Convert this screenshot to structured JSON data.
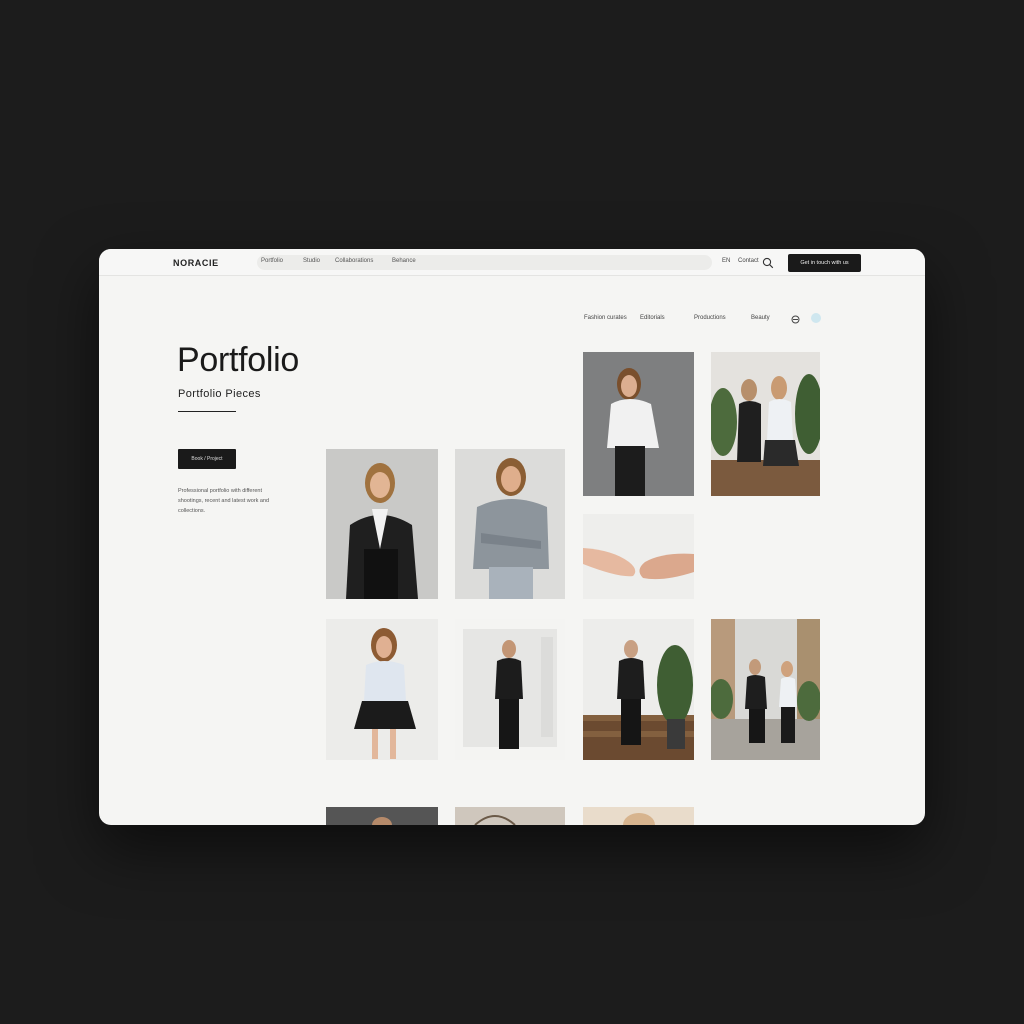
{
  "brand": "NORACIE",
  "nav": {
    "links": [
      "Portfolio",
      "Studio",
      "Collaborations",
      "Behance"
    ],
    "lang": "EN",
    "contact": "Contact",
    "cta": "Get in touch with us"
  },
  "filters": [
    "Fashion curates",
    "Editorials",
    "Productions",
    "Beauty"
  ],
  "hero": {
    "title": "Portfolio",
    "subtitle": "Portfolio Pieces",
    "button": "Book / Project",
    "description": "Professional portfolio with different shootings, recent and latest work and collections."
  },
  "gallery": [
    "woman-black-blazer",
    "woman-grey-shirt",
    "woman-white-shirt-grey-studio",
    "two-women-plants",
    "hands-touching",
    "woman-pleated-skirt",
    "man-white-room",
    "man-wooden-stairs",
    "couple-street"
  ],
  "colors": {
    "background": "#1c1c1c",
    "page": "#f5f5f3",
    "accent": "#1a1a1a",
    "dot": "#cfe7ef"
  }
}
